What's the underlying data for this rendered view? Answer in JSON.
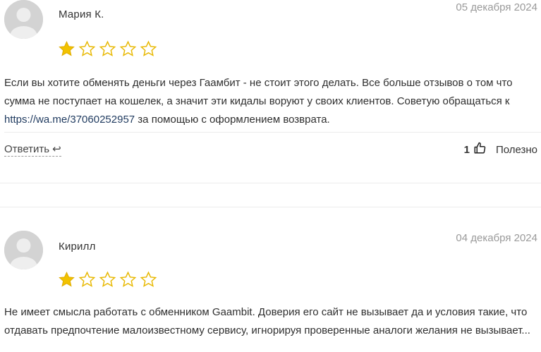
{
  "reviews": [
    {
      "author": "Мария К.",
      "date": "05 декабря 2024",
      "rating": 1,
      "max_rating": 5,
      "text_before_link": "Если вы хотите обменять деньги через Гаамбит - не стоит этого делать. Все больше отзывов о том что сумма не поступает на кошелек, а значит эти кидалы воруют у своих клиентов. Советую обращаться к ",
      "link": "https://wa.me/37060252957",
      "text_after_link": " за помощью с оформлением возврата.",
      "reply_label": "Ответить",
      "useful_count": "1",
      "useful_label": "Полезно"
    },
    {
      "author": "Кирилл",
      "date": "04 декабря 2024",
      "rating": 1,
      "max_rating": 5,
      "text": "Не имеет смысла работать с обменником Gaambit. Доверия его сайт не вызывает да и условия такие, что отдавать предпочтение малоизвестному сервису, игнорируя проверенные аналоги желания не вызывает..."
    }
  ],
  "colors": {
    "star_filled": "#f2c200",
    "star_empty_stroke": "#e8b800",
    "link": "#1f3a5f"
  }
}
